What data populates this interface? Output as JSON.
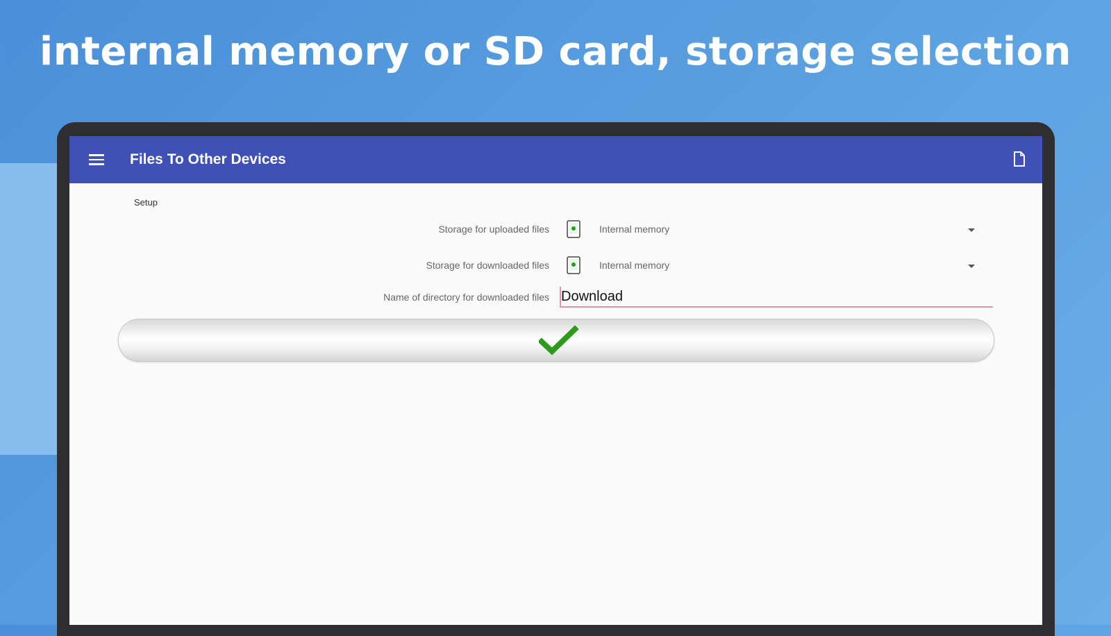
{
  "headline": "internal memory or SD card, storage selection",
  "app": {
    "title": "Files To Other Devices",
    "menu_icon": "hamburger-menu-icon",
    "action_icon": "file-icon",
    "bar_color": "#3f51b5"
  },
  "setup": {
    "section_label": "Setup",
    "upload_storage": {
      "label": "Storage for uploaded files",
      "value": "Internal memory",
      "icon": "phone-storage-icon"
    },
    "download_storage": {
      "label": "Storage for downloaded files",
      "value": "Internal memory",
      "icon": "phone-storage-icon"
    },
    "directory": {
      "label": "Name of directory for downloaded files",
      "value": "Download"
    },
    "confirm_icon": "checkmark-icon",
    "confirm_color": "#2e9a1c"
  }
}
